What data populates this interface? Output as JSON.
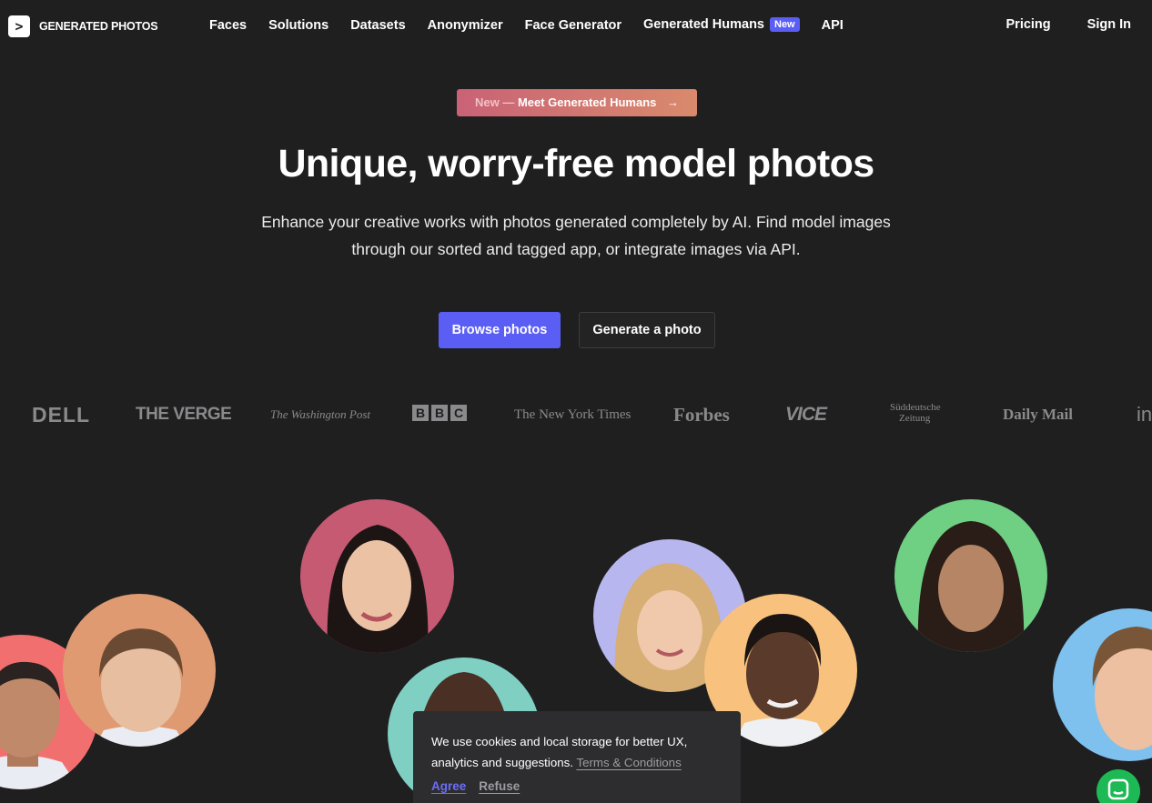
{
  "header": {
    "logo_mark": ">",
    "logo_text": "GENERATED PHOTOS",
    "nav": [
      "Faces",
      "Solutions",
      "Datasets",
      "Anonymizer",
      "Face Generator",
      "Generated Humans",
      "API"
    ],
    "new_badge": "New",
    "pricing": "Pricing",
    "sign_in": "Sign In"
  },
  "hero": {
    "pill_muted": "New —",
    "pill_text": "Meet Generated Humans",
    "pill_arrow": "→",
    "title": "Unique, worry-free model photos",
    "subtitle_line1": "Enhance your creative works with photos generated completely by AI. Find model images",
    "subtitle_line2": "through our sorted and tagged app, or integrate images via API.",
    "browse_button": "Browse photos",
    "generate_button": "Generate a photo"
  },
  "press": {
    "dell": "DELL",
    "verge": "THE VERGE",
    "wapo": "The Washington Post",
    "bbc": [
      "B",
      "B",
      "C"
    ],
    "nyt": "The New York Times",
    "forbes": "Forbes",
    "vice": "VICE",
    "sz_line1": "Süddeutsche",
    "sz_line2": "Zeitung",
    "daily": "Daily Mail",
    "in": "in"
  },
  "faces": {
    "colors": {
      "woman_asian_bg": "#c65a72",
      "boy_bg": "#e09a72",
      "man_left_bg": "#f26f6f",
      "woman_teal_bg": "#7fd0c3",
      "girl_bg": "#b8b6ee",
      "man_dark_bg": "#f8c27e",
      "woman_green_bg": "#6fcf83",
      "man_right_bg": "#7ec1ee"
    }
  },
  "cookie": {
    "text_line1": "We use cookies and local storage for better UX,",
    "text_line2": "analytics and suggestions.",
    "terms_link": "Terms & Conditions",
    "agree": "Agree",
    "refuse": "Refuse"
  }
}
